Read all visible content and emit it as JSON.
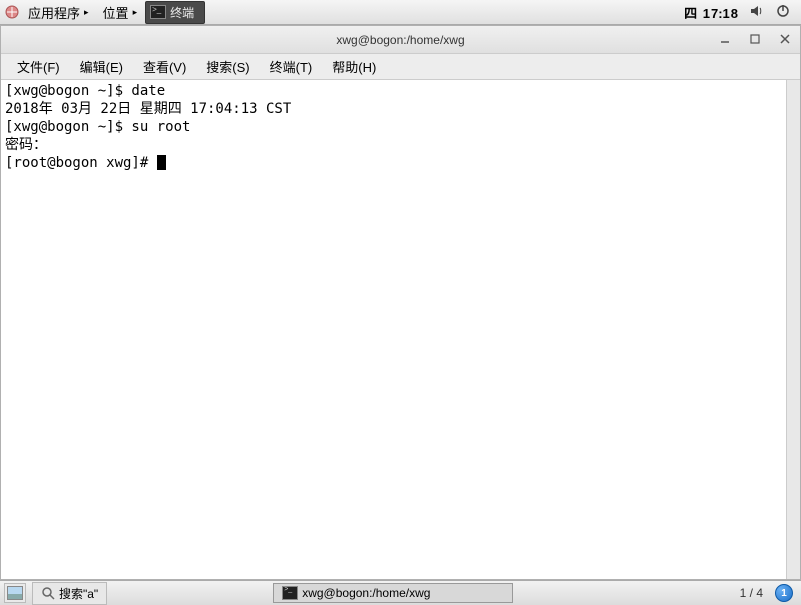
{
  "panel": {
    "apps_label": "应用程序",
    "places_label": "位置",
    "running_app": "终端",
    "day": "四",
    "hour": "17",
    "minute": "18"
  },
  "window": {
    "title": "xwg@bogon:/home/xwg",
    "controls": {
      "minimize": "—",
      "maximize": "□",
      "close": "×"
    }
  },
  "menubar": {
    "file": "文件(F)",
    "edit": "编辑(E)",
    "view": "查看(V)",
    "search": "搜索(S)",
    "terminal": "终端(T)",
    "help": "帮助(H)"
  },
  "terminal": {
    "line1": "[xwg@bogon ~]$ date",
    "line2": "2018年 03月 22日 星期四 17:04:13 CST",
    "line3": "[xwg@bogon ~]$ su root",
    "line4": "密码：",
    "line5": "[root@bogon xwg]# "
  },
  "bottom": {
    "search_task": "搜索\"a\"",
    "terminal_task": "xwg@bogon:/home/xwg",
    "workspace": "1 / 4",
    "badge": "1"
  }
}
